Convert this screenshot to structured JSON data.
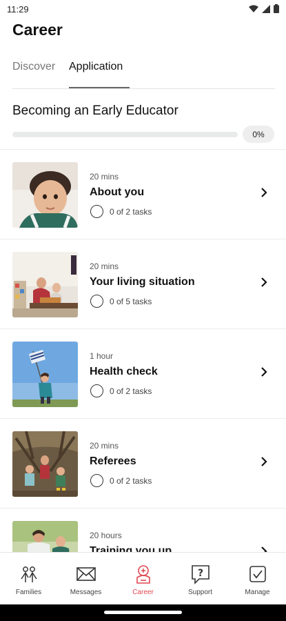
{
  "status": {
    "time": "11:29"
  },
  "header": {
    "title": "Career"
  },
  "tabs": [
    {
      "label": "Discover",
      "active": false
    },
    {
      "label": "Application",
      "active": true
    }
  ],
  "plan": {
    "title": "Becoming an Early Educator",
    "progress_label": "0%",
    "progress_fraction": 0
  },
  "modules": [
    {
      "duration": "20 mins",
      "title": "About you",
      "tasks": "0 of 2 tasks",
      "image": "child-portrait"
    },
    {
      "duration": "20 mins",
      "title": "Your living situation",
      "tasks": "0 of 5 tasks",
      "image": "living-room-play"
    },
    {
      "duration": "1 hour",
      "title": "Health check",
      "tasks": "0 of 2 tasks",
      "image": "child-with-flag"
    },
    {
      "duration": "20 mins",
      "title": "Referees",
      "tasks": "0 of 2 tasks",
      "image": "children-outdoor-play"
    },
    {
      "duration": "20 hours",
      "title": "Training you up",
      "tasks": "",
      "image": "children-smiling"
    }
  ],
  "bottom_nav": [
    {
      "label": "Families",
      "icon": "families-icon",
      "active": false
    },
    {
      "label": "Messages",
      "icon": "envelope-icon",
      "active": false
    },
    {
      "label": "Career",
      "icon": "career-icon",
      "active": true
    },
    {
      "label": "Support",
      "icon": "support-icon",
      "active": false
    },
    {
      "label": "Manage",
      "icon": "manage-icon",
      "active": false
    }
  ],
  "colors": {
    "accent": "#e0474f",
    "progress": "#2aa39a",
    "text": "#111111"
  }
}
